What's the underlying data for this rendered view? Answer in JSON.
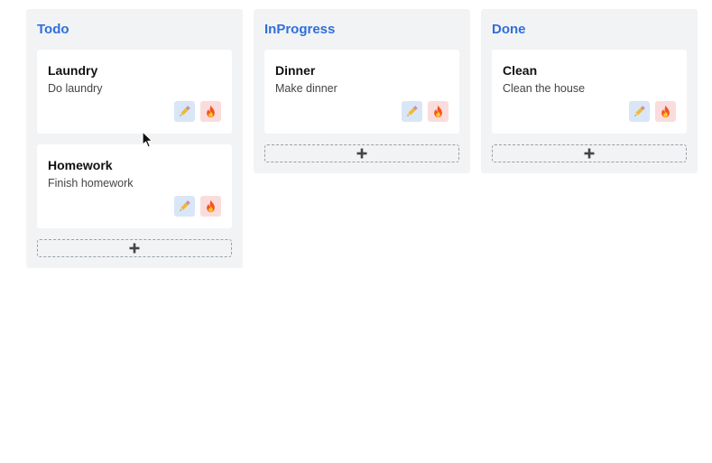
{
  "colors": {
    "column_bg": "#f2f3f5",
    "title_blue": "#2f6fdb",
    "edit_bg": "#d9e6f6",
    "delete_bg": "#fbdcdc"
  },
  "icons": {
    "edit": "pencil-icon",
    "delete": "fire-icon",
    "add": "plus-icon"
  },
  "columns": [
    {
      "title": "Todo",
      "cards": [
        {
          "title": "Laundry",
          "desc": "Do laundry"
        },
        {
          "title": "Homework",
          "desc": "Finish homework"
        }
      ]
    },
    {
      "title": "InProgress",
      "cards": [
        {
          "title": "Dinner",
          "desc": "Make dinner"
        }
      ]
    },
    {
      "title": "Done",
      "cards": [
        {
          "title": "Clean",
          "desc": "Clean the house"
        }
      ]
    }
  ]
}
